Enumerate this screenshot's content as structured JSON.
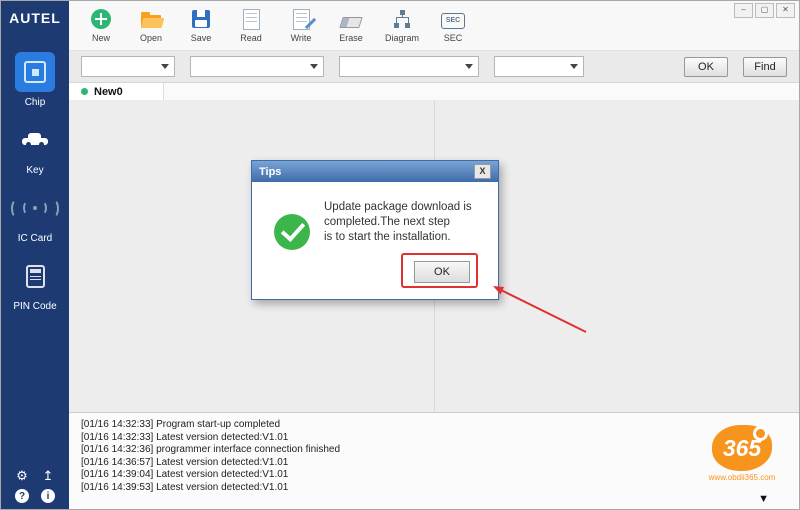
{
  "brand": {
    "logo": "AUTEL"
  },
  "window": {
    "controls": {
      "minimize": "–",
      "maximize": "▢",
      "close": "✕"
    }
  },
  "toolbar": {
    "items": [
      {
        "label": "New"
      },
      {
        "label": "Open"
      },
      {
        "label": "Save"
      },
      {
        "label": "Read"
      },
      {
        "label": "Write"
      },
      {
        "label": "Erase"
      },
      {
        "label": "Diagram"
      },
      {
        "label": "SEC",
        "icon_text": "SEC"
      }
    ]
  },
  "filters": {
    "ok_label": "OK",
    "find_label": "Find"
  },
  "tabs": {
    "active_label": "New0"
  },
  "sidebar": {
    "items": [
      {
        "label": "Chip"
      },
      {
        "label": "Key"
      },
      {
        "label": "IC Card"
      },
      {
        "label": "PIN Code"
      }
    ],
    "bottom_icons": [
      {
        "glyph": "⚙"
      },
      {
        "glyph": "↥"
      },
      {
        "glyph": "?"
      },
      {
        "glyph": "i"
      }
    ]
  },
  "dialog": {
    "title": "Tips",
    "close_glyph": "X",
    "message_lines": [
      "Update package download is",
      "completed.The next step",
      "is to start the installation."
    ],
    "ok_label": "OK"
  },
  "log": {
    "lines": [
      "[01/16 14:32:33] Program start-up completed",
      "[01/16 14:32:33] Latest version detected:V1.01",
      "[01/16 14:32:36] programmer interface connection finished",
      "[01/16 14:36:57] Latest version detected:V1.01",
      "[01/16 14:39:04] Latest version detected:V1.01",
      "[01/16 14:39:53] Latest version detected:V1.01"
    ]
  },
  "watermark": {
    "number": "365",
    "url": "www.obdii365.com"
  },
  "icons": {
    "scroll_down": "▼"
  },
  "colors": {
    "accent_blue": "#2a7ce0",
    "sidebar": "#1d3b72",
    "success_green": "#3cb54a",
    "annotation_red": "#e0312e",
    "brand_orange": "#f7941d"
  }
}
